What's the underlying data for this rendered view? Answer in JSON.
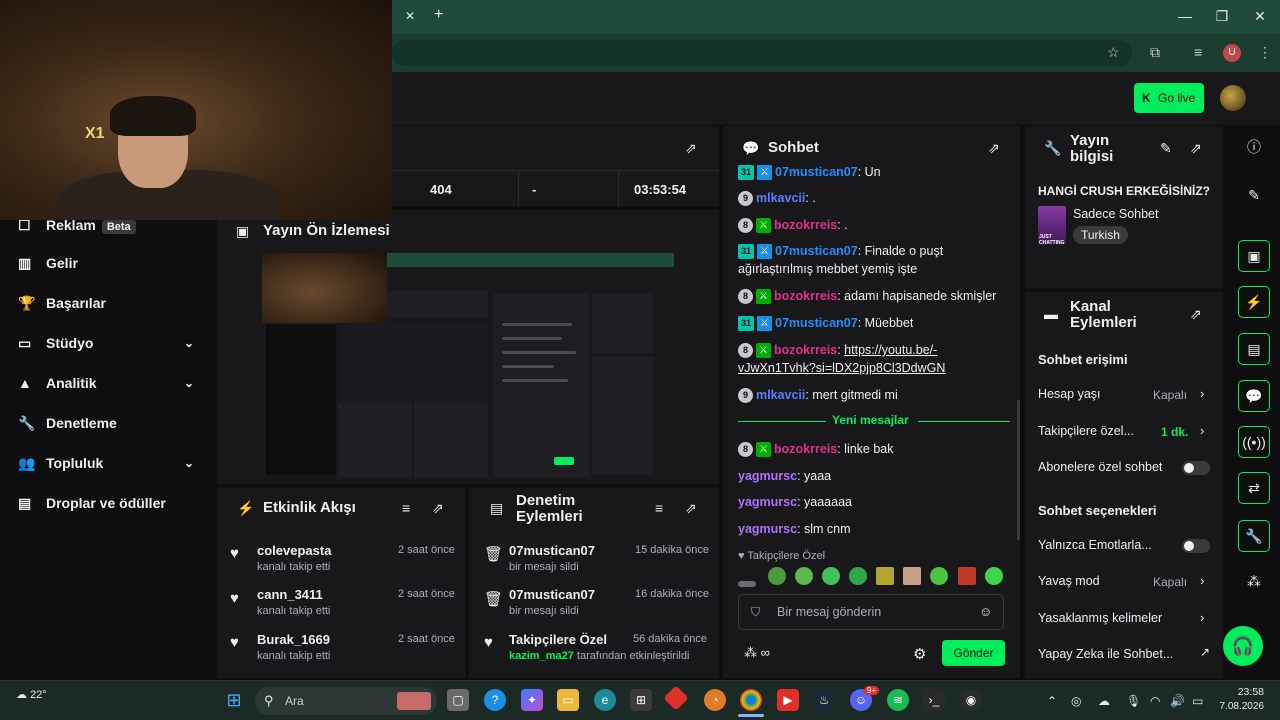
{
  "browser": {
    "new_tab_symbol": "+",
    "close_tab_symbol": "✕",
    "window_controls": {
      "minimize": "—",
      "maximize": "❐",
      "close": "✕"
    },
    "profile_initial": "U"
  },
  "header": {
    "go_live_label": "Go live",
    "go_live_icon": "K"
  },
  "webcam": {
    "sign_text": "X1"
  },
  "sidebar": {
    "items": [
      {
        "label": "Reklam",
        "badge": "Beta",
        "icon": "ad-icon",
        "glyph": "☐"
      },
      {
        "label": "Gelir",
        "icon": "revenue-icon",
        "glyph": "▥"
      },
      {
        "label": "Başarılar",
        "icon": "trophy-icon",
        "glyph": "🏆"
      },
      {
        "label": "Stüdyo",
        "icon": "studio-icon",
        "glyph": "▭",
        "expandable": true
      },
      {
        "label": "Analitik",
        "icon": "analytics-icon",
        "glyph": "▲",
        "expandable": true
      },
      {
        "label": "Denetleme",
        "icon": "wrench-icon",
        "glyph": "🔧"
      },
      {
        "label": "Topluluk",
        "icon": "community-icon",
        "glyph": "👥",
        "expandable": true
      },
      {
        "label": "Droplar ve ödüller",
        "icon": "drops-icon",
        "glyph": "▤"
      }
    ]
  },
  "stats": {
    "viewers": "404",
    "followers": "-",
    "uptime": "03:53:54"
  },
  "preview": {
    "title": "Yayın Ön İzlemesi"
  },
  "activity": {
    "title": "Etkinlik Akışı",
    "items": [
      {
        "name": "colevepasta",
        "action": "kanalı takip etti",
        "time": "2 saat önce"
      },
      {
        "name": "cann_3411",
        "action": "kanalı takip etti",
        "time": "2 saat önce"
      },
      {
        "name": "Burak_1669",
        "action": "kanalı takip etti",
        "time": "2 saat önce"
      }
    ]
  },
  "moderation": {
    "title_line1": "Denetim",
    "title_line2": "Eylemleri",
    "items": [
      {
        "name": "07mustican07",
        "action": "bir mesajı sildi",
        "time": "15 dakika önce",
        "icon": "trash-icon"
      },
      {
        "name": "07mustican07",
        "action": "bir mesajı sildi",
        "time": "16 dakika önce",
        "icon": "trash-icon"
      },
      {
        "name": "Takipçilere Özel",
        "actor": "kazim_ma27",
        "action": "tarafından etkinleştirildi",
        "time": "56 dakika önce",
        "icon": "heart-icon"
      }
    ]
  },
  "chat": {
    "title": "Sohbet",
    "messages": [
      {
        "badges": [
          "31",
          "sword"
        ],
        "user": "07mustican07",
        "cls": "u-07",
        "text": "Un"
      },
      {
        "badges": [
          "9"
        ],
        "user": "mlkavcii",
        "cls": "u-mlk",
        "text": "."
      },
      {
        "badges": [
          "8",
          "mod"
        ],
        "user": "bozokrreis",
        "cls": "u-bozo",
        "text": "."
      },
      {
        "badges": [
          "31",
          "sword"
        ],
        "user": "07mustican07",
        "cls": "u-07",
        "text": "Finalde o puşt ağırlaştırılmış mebbet yemiş işte"
      },
      {
        "badges": [
          "8",
          "mod"
        ],
        "user": "bozokrreis",
        "cls": "u-bozo",
        "text": "adamı hapisanede skmişler"
      },
      {
        "badges": [
          "31",
          "sword"
        ],
        "user": "07mustican07",
        "cls": "u-07",
        "text": "Müebbet"
      },
      {
        "badges": [
          "8",
          "mod"
        ],
        "user": "bozokrreis",
        "cls": "u-bozo",
        "text": "https://youtu.be/-vJwXn1Tvhk?si=lDX2pjp8Cl3DdwGN",
        "link": true
      },
      {
        "badges": [
          "9"
        ],
        "user": "mlkavcii",
        "cls": "u-mlk",
        "text": "mert gitmedi mi"
      }
    ],
    "new_messages_label": "Yeni mesajlar",
    "new_messages": [
      {
        "badges": [
          "8",
          "mod"
        ],
        "user": "bozokrreis",
        "cls": "u-bozo",
        "text": "linke bak"
      },
      {
        "badges": [],
        "user": "yagmursc",
        "cls": "u-yag",
        "text": "yaaa"
      },
      {
        "badges": [],
        "user": "yagmursc",
        "cls": "u-yag",
        "text": "yaaaaaa"
      },
      {
        "badges": [],
        "user": "yagmursc",
        "cls": "u-yag",
        "text": "slm cnm"
      }
    ],
    "followers_only_label": "♥ Takipçilere Özel",
    "input_placeholder": "Bir mesaj gönderin",
    "send_label": "Gönder"
  },
  "stream_info": {
    "title_line1": "Yayın",
    "title_line2": "bilgisi",
    "stream_title": "HANGİ CRUSH ERKEĞİSİNİZ?",
    "category": "Sadece Sohbet",
    "tag": "Turkish",
    "thumb_text": "JUST CHATTING"
  },
  "channel_actions": {
    "title_line1": "Kanal",
    "title_line2": "Eylemleri",
    "chat_access_heading": "Sohbet erişimi",
    "account_age_label": "Hesap yaşı",
    "account_age_value": "Kapalı",
    "followers_only_label": "Takipçilere özel...",
    "followers_only_value": "1 dk.",
    "subscribers_only_label": "Abonelere özel sohbet",
    "chat_options_heading": "Sohbet seçenekleri",
    "emote_only_label": "Yalnızca Emotlarla...",
    "slow_mode_label": "Yavaş mod",
    "slow_mode_value": "Kapalı",
    "banned_words_label": "Yasaklanmış kelimeler",
    "ai_chat_label": "Yapay Zeka ile Sohbet..."
  },
  "taskbar": {
    "weather": "22°",
    "search_placeholder": "Ara",
    "time": "23:58",
    "date": "7.08.2026",
    "discord_badge": "9+"
  },
  "colors": {
    "accent": "#00ee5b",
    "panel": "#18181b",
    "background": "#0e0e10",
    "chrome": "#1f4b3a"
  }
}
